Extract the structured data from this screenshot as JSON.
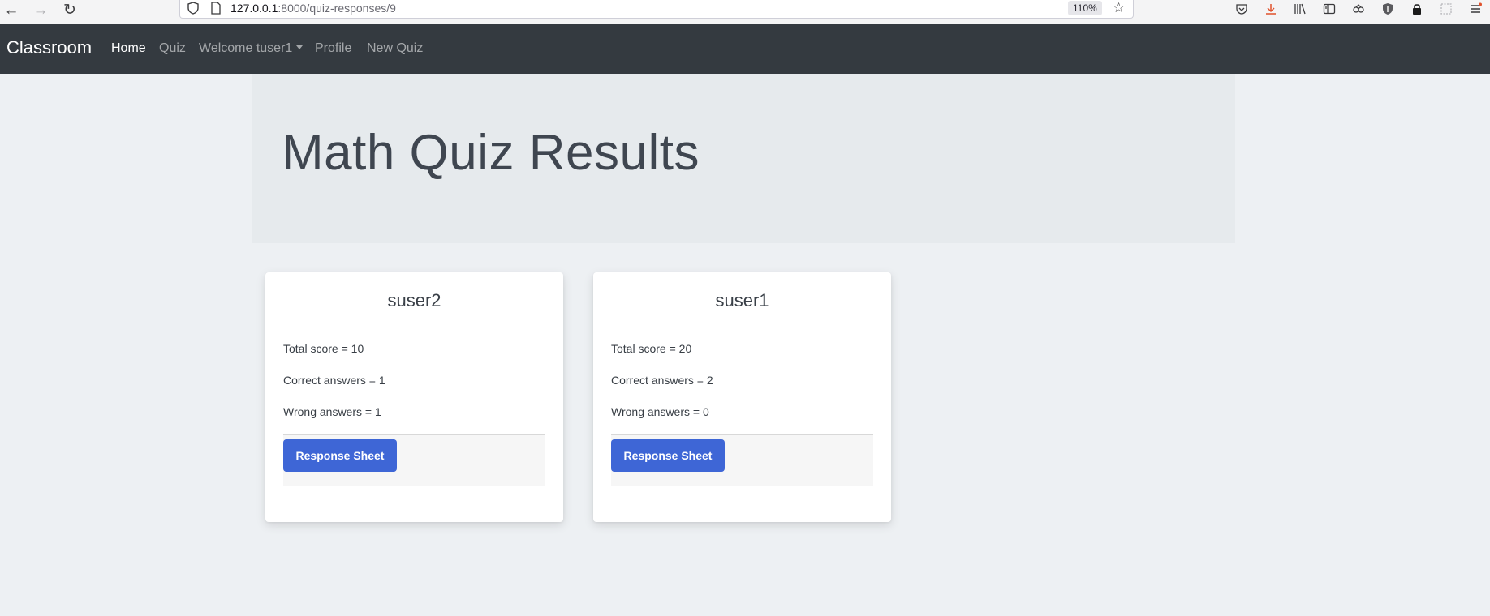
{
  "browser": {
    "url_host": "127.0.0.1",
    "url_path": ":8000/quiz-responses/9",
    "zoom": "110%"
  },
  "navbar": {
    "brand": "Classroom",
    "links": [
      {
        "label": "Home",
        "active": true
      },
      {
        "label": "Quiz",
        "active": false
      },
      {
        "label": "Welcome tuser1",
        "active": false,
        "dropdown": true
      },
      {
        "label": "Profile",
        "active": false
      },
      {
        "label": "New Quiz",
        "active": false
      }
    ]
  },
  "page": {
    "title": "Math Quiz Results"
  },
  "results": [
    {
      "name": "suser2",
      "total_score": "Total score = 10",
      "correct": "Correct answers = 1",
      "wrong": "Wrong answers = 1",
      "button_label": "Response Sheet"
    },
    {
      "name": "suser1",
      "total_score": "Total score = 20",
      "correct": "Correct answers = 2",
      "wrong": "Wrong answers = 0",
      "button_label": "Response Sheet"
    }
  ],
  "colors": {
    "navbar_bg": "#343a40",
    "page_bg": "#edf0f3",
    "jumbotron_bg": "#e6eaed",
    "primary_button": "#3e66d6"
  }
}
